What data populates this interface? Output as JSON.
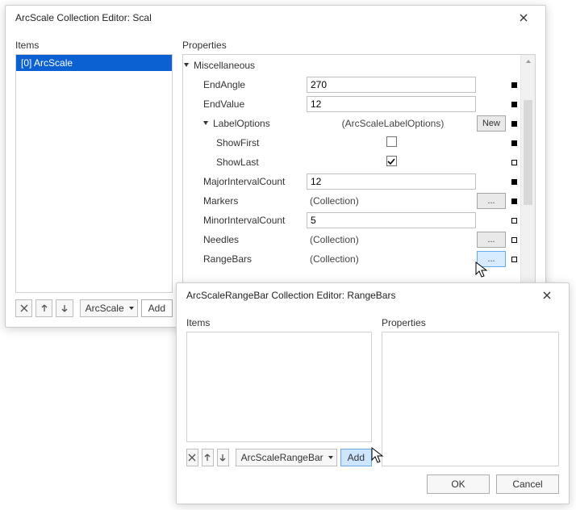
{
  "dlg1": {
    "title": "ArcScale Collection Editor: Scal",
    "items_label": "Items",
    "props_label": "Properties",
    "list": [
      {
        "text": "[0] ArcScale",
        "selected": true
      }
    ],
    "type_label": "ArcScale",
    "add_label": "Add",
    "grid": {
      "group_label": "Miscellaneous",
      "rows": [
        {
          "indent": 1,
          "name": "EndAngle",
          "kind": "text",
          "value": "270",
          "mark": "full"
        },
        {
          "indent": 1,
          "name": "EndValue",
          "kind": "text",
          "value": "12",
          "mark": "full"
        },
        {
          "indent": 1,
          "name": "LabelOptions",
          "kind": "new",
          "value": "(ArcScaleLabelOptions)",
          "btn": "New",
          "mark": "full",
          "expand": true
        },
        {
          "indent": 2,
          "name": "ShowFirst",
          "kind": "check",
          "checked": false,
          "mark": "full"
        },
        {
          "indent": 2,
          "name": "ShowLast",
          "kind": "check",
          "checked": true,
          "mark": "empty"
        },
        {
          "indent": 1,
          "name": "MajorIntervalCount",
          "kind": "text",
          "value": "12",
          "mark": "full",
          "sep": true
        },
        {
          "indent": 1,
          "name": "Markers",
          "kind": "coll",
          "value": "(Collection)",
          "btn": "...",
          "mark": "full"
        },
        {
          "indent": 1,
          "name": "MinorIntervalCount",
          "kind": "text",
          "value": "5",
          "mark": "empty"
        },
        {
          "indent": 1,
          "name": "Needles",
          "kind": "coll",
          "value": "(Collection)",
          "btn": "...",
          "mark": "empty"
        },
        {
          "indent": 1,
          "name": "RangeBars",
          "kind": "coll",
          "value": "(Collection)",
          "btn": "...",
          "mark": "empty",
          "btn_sel": true
        }
      ]
    }
  },
  "dlg2": {
    "title": "ArcScaleRangeBar Collection Editor: RangeBars",
    "items_label": "Items",
    "props_label": "Properties",
    "type_label": "ArcScaleRangeBar",
    "add_label": "Add",
    "ok_label": "OK",
    "cancel_label": "Cancel"
  }
}
